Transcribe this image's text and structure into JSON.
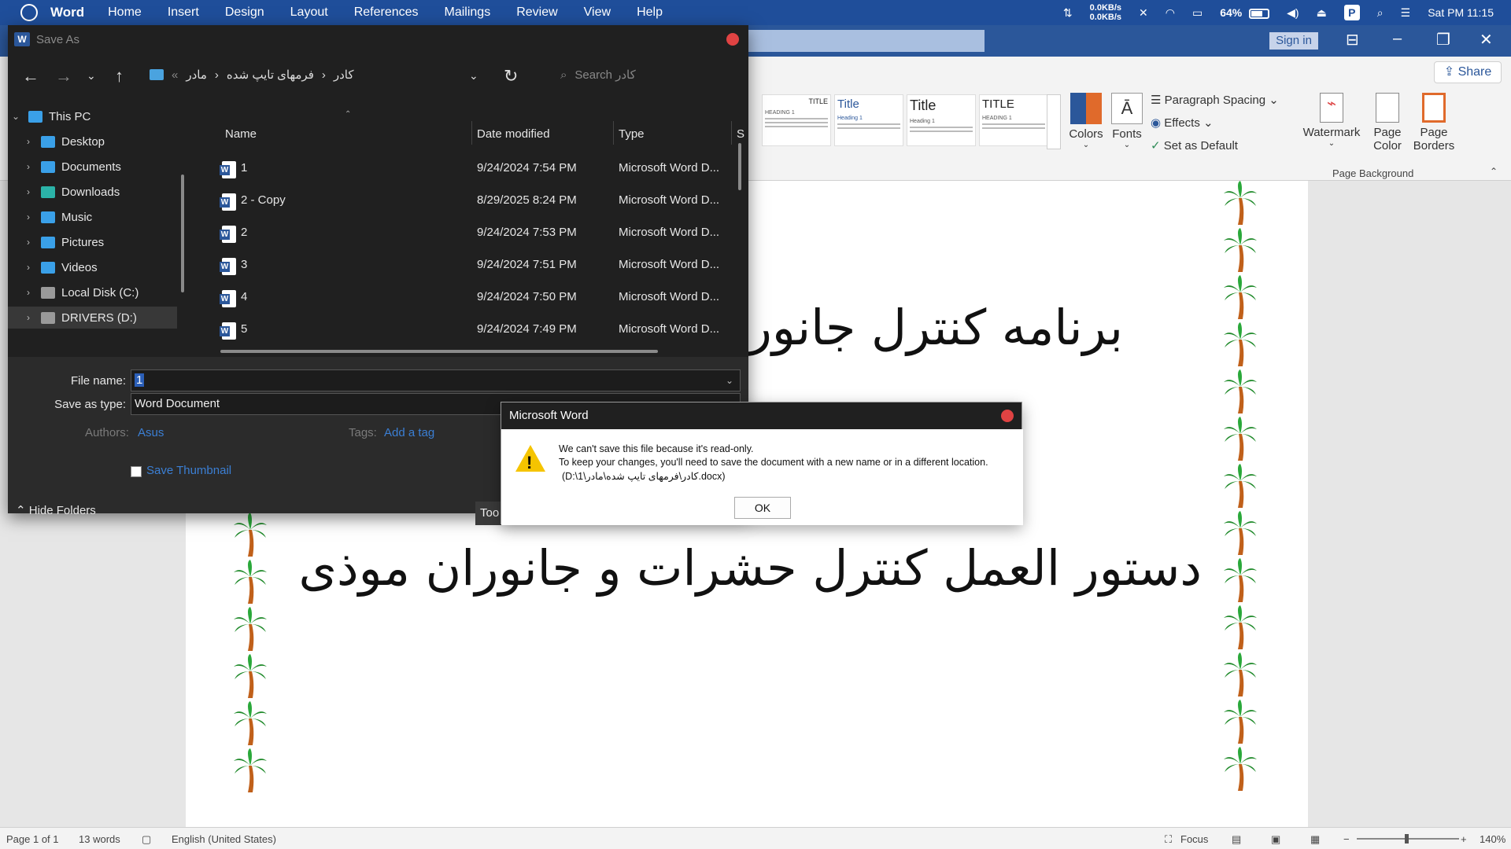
{
  "menubar": {
    "app": "Word",
    "items": [
      "Home",
      "Insert",
      "Design",
      "Layout",
      "References",
      "Mailings",
      "Review",
      "View",
      "Help"
    ],
    "net_up": "0.0KB/s",
    "net_down": "0.0KB/s",
    "battery": "64%",
    "battery_level": 0.64,
    "badge": "P",
    "clock": "Sat PM 11:15"
  },
  "titleband": {
    "signin": "Sign in"
  },
  "ribbon": {
    "share": "Share",
    "style_thumbs": [
      {
        "heading": "TITLE",
        "sub": "HEADING 1"
      },
      {
        "heading": "Title",
        "sub": "Heading 1"
      },
      {
        "heading": "Title",
        "sub": "Heading 1"
      },
      {
        "heading": "TITLE",
        "sub": "HEADING 1"
      }
    ],
    "colors": "Colors",
    "fonts": "Fonts",
    "paragraph_spacing": "Paragraph Spacing",
    "effects": "Effects",
    "set_default": "Set as Default",
    "watermark": "Watermark",
    "page_color_1": "Page",
    "page_color_2": "Color",
    "page_borders_1": "Page",
    "page_borders_2": "Borders",
    "group_page_background": "Page Background"
  },
  "document": {
    "line1": "برنامه کنترل جانور",
    "line2": "دستور العمل کنترل حشرات و جانوران موذی"
  },
  "statusbar": {
    "page": "Page 1 of 1",
    "words": "13 words",
    "language": "English (United States)",
    "focus": "Focus",
    "zoom": "140%"
  },
  "saveas": {
    "title": "Save As",
    "breadcrumb": [
      "مادر",
      "فرمهای تایپ شده",
      "کادر"
    ],
    "search_placeholder": "Search کادر",
    "tree": [
      "This PC",
      "Desktop",
      "Documents",
      "Downloads",
      "Music",
      "Pictures",
      "Videos",
      "Local Disk (C:)",
      "DRIVERS (D:)"
    ],
    "columns": {
      "name": "Name",
      "date": "Date modified",
      "type": "Type",
      "size": "S"
    },
    "files": [
      {
        "name": "1",
        "date": "9/24/2024 7:54 PM",
        "type": "Microsoft Word D..."
      },
      {
        "name": "2 - Copy",
        "date": "8/29/2025 8:24 PM",
        "type": "Microsoft Word D..."
      },
      {
        "name": "2",
        "date": "9/24/2024 7:53 PM",
        "type": "Microsoft Word D..."
      },
      {
        "name": "3",
        "date": "9/24/2024 7:51 PM",
        "type": "Microsoft Word D..."
      },
      {
        "name": "4",
        "date": "9/24/2024 7:50 PM",
        "type": "Microsoft Word D..."
      },
      {
        "name": "5",
        "date": "9/24/2024 7:49 PM",
        "type": "Microsoft Word D..."
      }
    ],
    "file_name_label": "File name:",
    "file_name_value": "1",
    "save_type_label": "Save as type:",
    "save_type_value": "Word Document",
    "authors_label": "Authors:",
    "authors_value": "Asus",
    "tags_label": "Tags:",
    "tags_value": "Add a tag",
    "thumbnail_label": "Save Thumbnail",
    "hide_folders": "Hide Folders",
    "tools": "Too"
  },
  "alert": {
    "title": "Microsoft Word",
    "line1": "We can't save this file because it's read-only.",
    "line2": "To keep your changes, you'll need to save the document with a new name or in a different location.",
    "line3": "(D:\\1\\کادر\\فرمهای تایپ شده\\مادر.docx)",
    "ok": "OK"
  },
  "colors": {
    "menubar": "#1f4e9a",
    "word_blue": "#2b579a",
    "dialog_bg": "#202020",
    "close_red": "#e04343",
    "warning_yellow": "#f5c400"
  }
}
